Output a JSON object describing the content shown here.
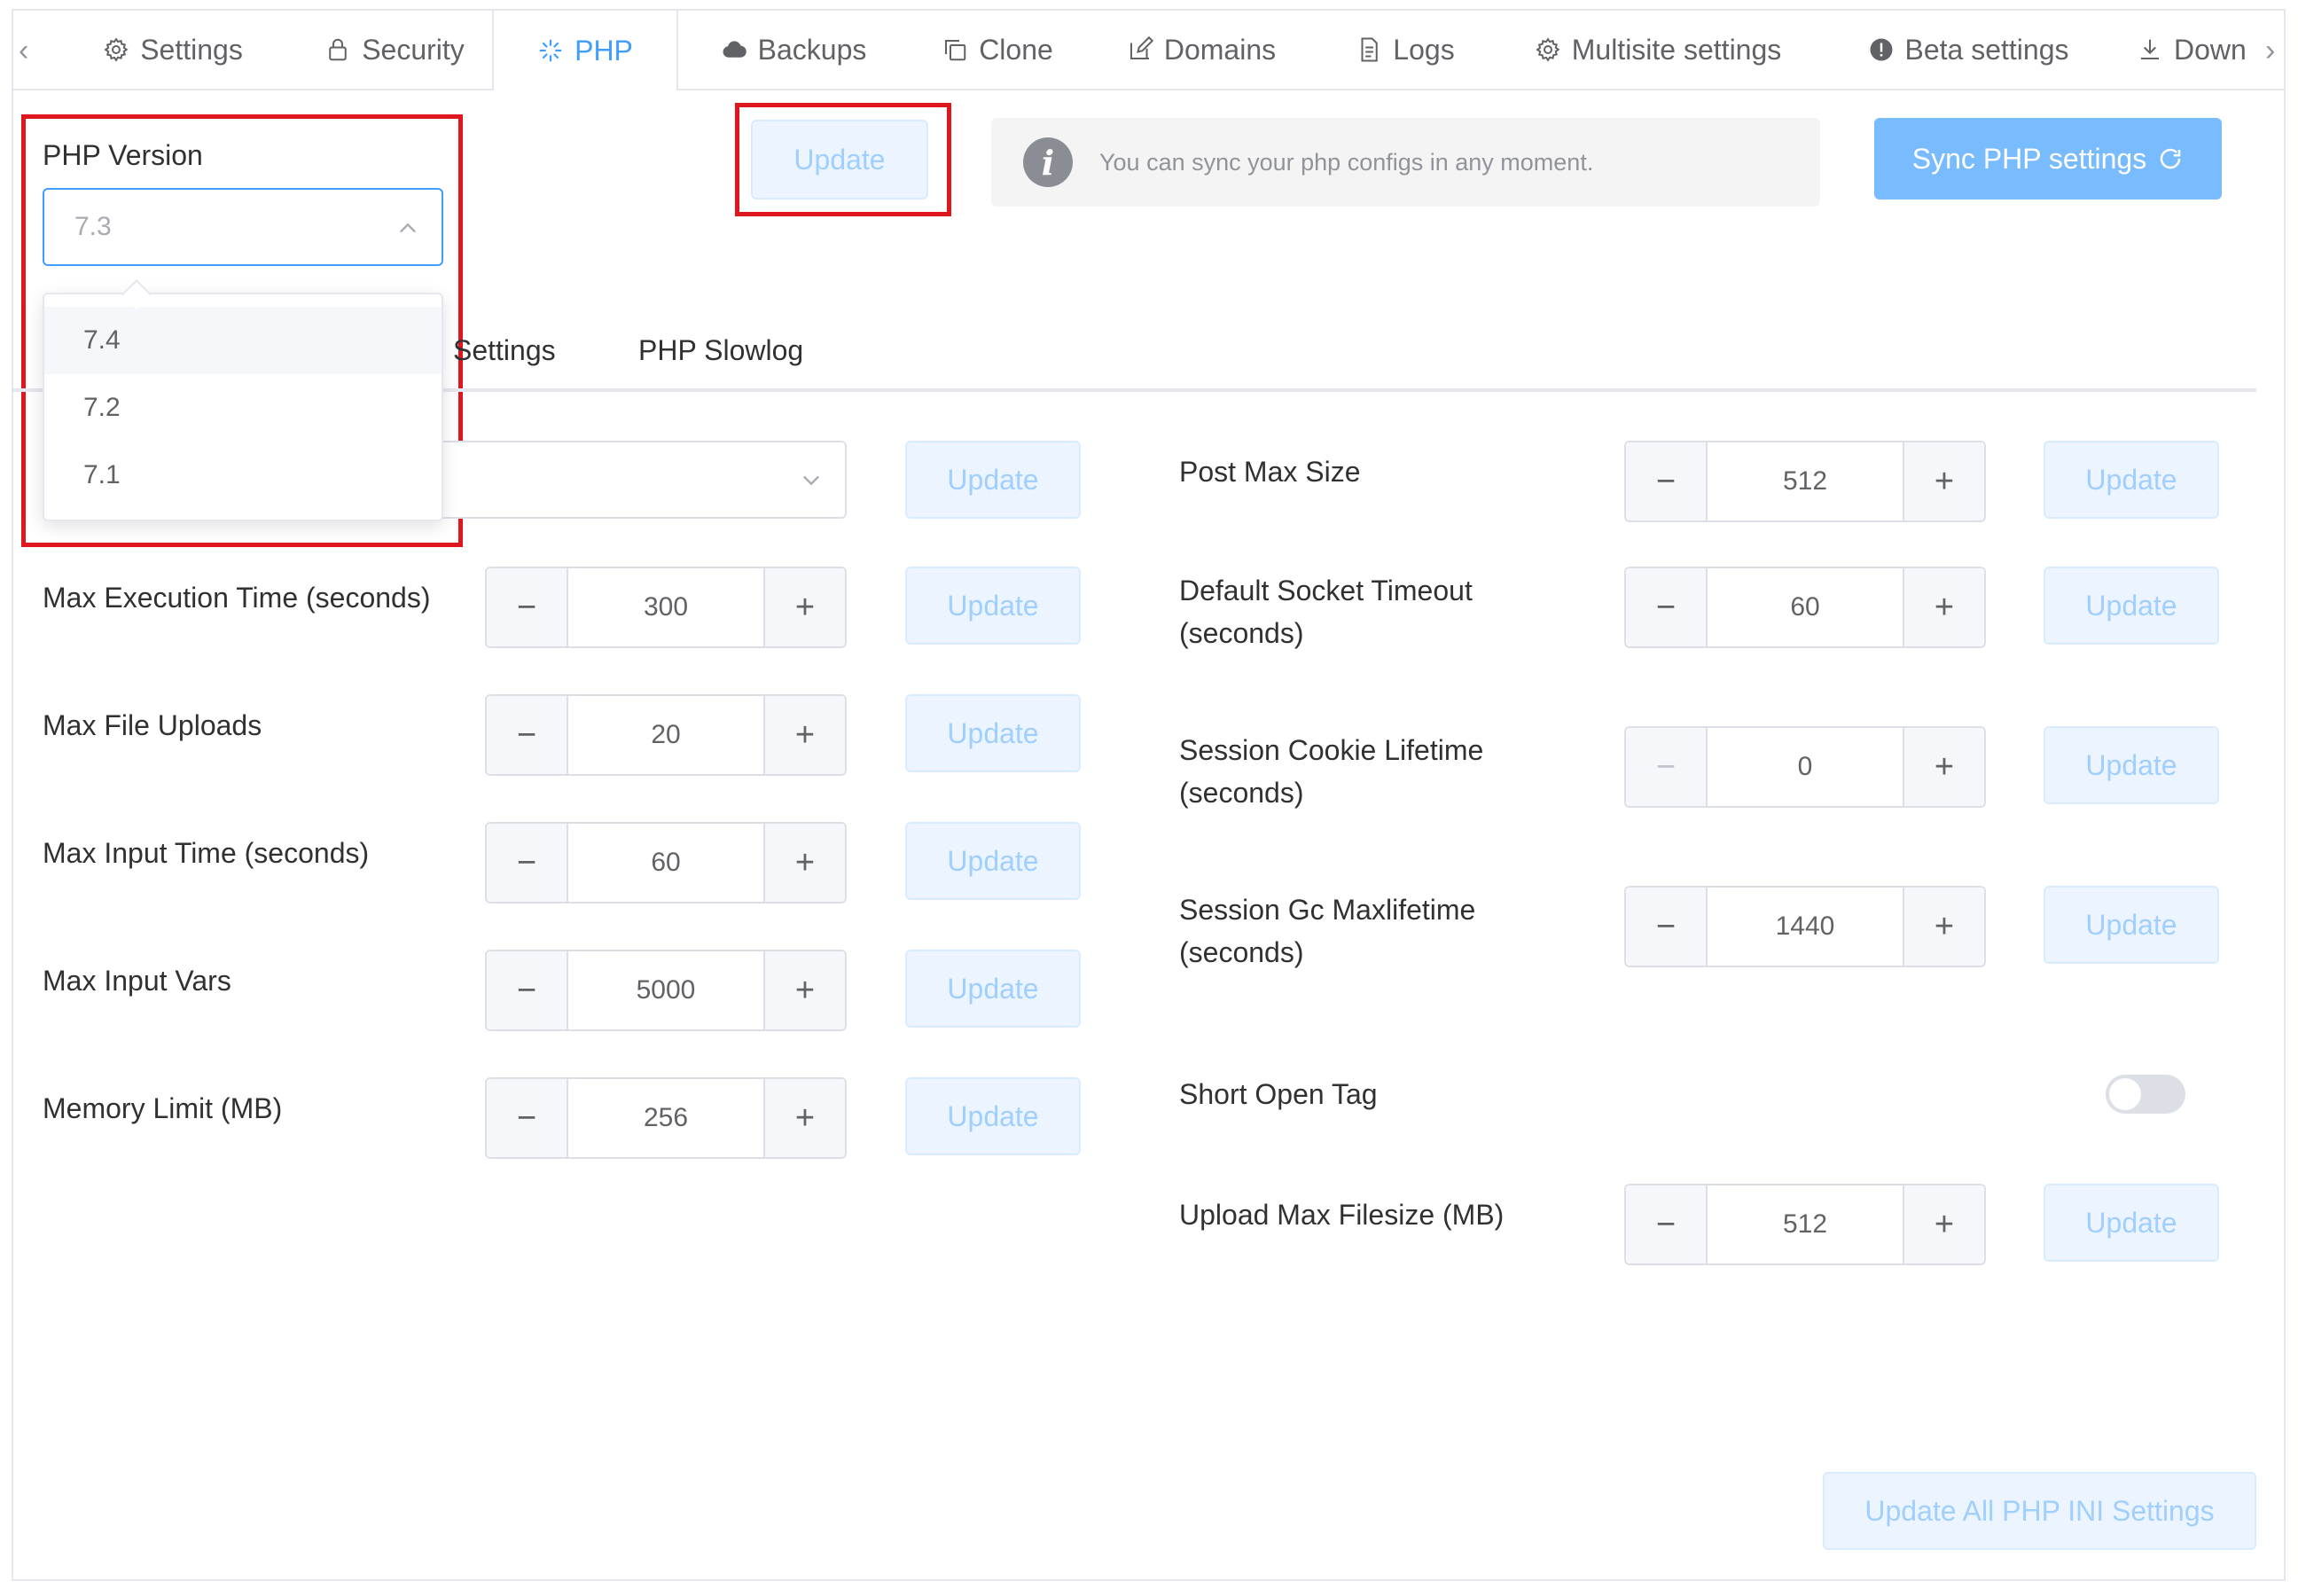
{
  "tabs": [
    {
      "label": "Settings",
      "icon": "gear-icon"
    },
    {
      "label": "Security",
      "icon": "lock-icon"
    },
    {
      "label": "PHP",
      "icon": "spinner-icon",
      "active": true
    },
    {
      "label": "Backups",
      "icon": "cloud-icon"
    },
    {
      "label": "Clone",
      "icon": "copy-icon"
    },
    {
      "label": "Domains",
      "icon": "edit-icon"
    },
    {
      "label": "Logs",
      "icon": "document-icon"
    },
    {
      "label": "Multisite settings",
      "icon": "gear-icon"
    },
    {
      "label": "Beta settings",
      "icon": "warning-icon"
    },
    {
      "label": "Down",
      "icon": "download-icon"
    }
  ],
  "php_version": {
    "label": "PHP Version",
    "selected": "7.3",
    "options": [
      "7.4",
      "7.2",
      "7.1"
    ],
    "update_label": "Update"
  },
  "info": {
    "message": "You can sync your php configs in any moment."
  },
  "sync_button": "Sync PHP settings",
  "subtabs": {
    "tab1_visible": "l Settings",
    "tab2": "PHP Slowlog"
  },
  "update_label": "Update",
  "left_settings": [
    {
      "label": "Max Execution Time (seconds)",
      "value": "300"
    },
    {
      "label": "Max File Uploads",
      "value": "20"
    },
    {
      "label": "Max Input Time (seconds)",
      "value": "60"
    },
    {
      "label": "Max Input Vars",
      "value": "5000"
    },
    {
      "label": "Memory Limit (MB)",
      "value": "256"
    }
  ],
  "right_settings": [
    {
      "label": "Post Max Size",
      "value": "512"
    },
    {
      "label": "Default Socket Timeout (seconds)",
      "value": "60"
    },
    {
      "label": "Session Cookie Lifetime (seconds)",
      "value": "0"
    },
    {
      "label": "Session Gc Maxlifetime (seconds)",
      "value": "1440"
    },
    {
      "label": "Short Open Tag",
      "toggle": false
    },
    {
      "label": "Upload Max Filesize (MB)",
      "value": "512"
    }
  ],
  "update_all_label": "Update All PHP INI Settings",
  "colors": {
    "accent": "#409eff",
    "primary_button": "#79bbff",
    "light_button_bg": "#ecf5ff",
    "highlight_box": "#e0161e"
  }
}
